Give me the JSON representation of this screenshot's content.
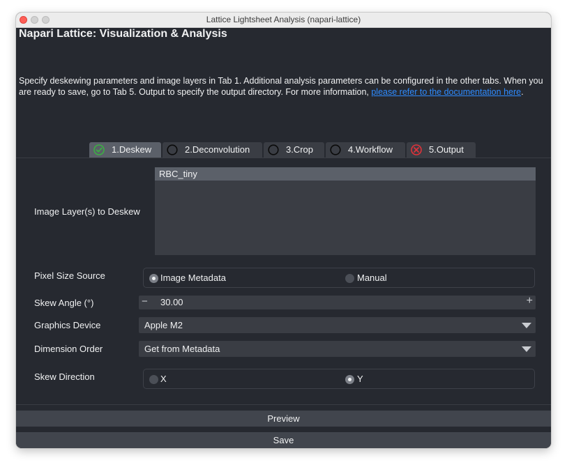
{
  "window": {
    "title": "Lattice Lightsheet Analysis (napari-lattice)"
  },
  "app": {
    "title": "Napari Lattice: Visualization & Analysis",
    "description": "Specify deskewing parameters and image layers in Tab 1.  Additional analysis parameters can be configured in the other tabs.  When you are ready to save, go to Tab 5.  Output to specify the output directory.  For more information, ",
    "doc_link": "please refer to the documentation here",
    "description_end": "."
  },
  "tabs": [
    {
      "label": "1.Deskew",
      "status": "complete",
      "active": true
    },
    {
      "label": "2.Deconvolution",
      "status": "empty",
      "active": false
    },
    {
      "label": "3.Crop",
      "status": "empty",
      "active": false
    },
    {
      "label": "4.Workflow",
      "status": "empty",
      "active": false
    },
    {
      "label": "5.Output",
      "status": "error",
      "active": false
    }
  ],
  "deskew": {
    "image_layers_label": "Image Layer(s) to Deskew",
    "image_layers": [
      "RBC_tiny"
    ],
    "pixel_size_source_label": "Pixel Size Source",
    "pixel_size_options": [
      "Image Metadata",
      "Manual"
    ],
    "pixel_size_selected": "Image Metadata",
    "skew_angle_label": "Skew Angle (°)",
    "skew_angle_value": "30.00",
    "minus_symbol": "−",
    "plus_symbol": "+",
    "graphics_device_label": "Graphics Device",
    "graphics_device_value": "Apple M2",
    "dimension_order_label": "Dimension Order",
    "dimension_order_value": "Get from Metadata",
    "skew_direction_label": "Skew Direction",
    "skew_direction_options": [
      "X",
      "Y"
    ],
    "skew_direction_selected": "Y"
  },
  "actions": {
    "preview": "Preview",
    "save": "Save"
  },
  "colors": {
    "background": "#262930",
    "control": "#3a3d44",
    "selected": "#5b6069",
    "complete_icon": "#3cb043",
    "error_icon": "#e0323a",
    "link": "#2e8bff"
  },
  "icons": {
    "complete": "check-circle-icon",
    "empty": "empty-circle-icon",
    "error": "x-circle-icon",
    "dropdown": "chevron-down-icon"
  }
}
